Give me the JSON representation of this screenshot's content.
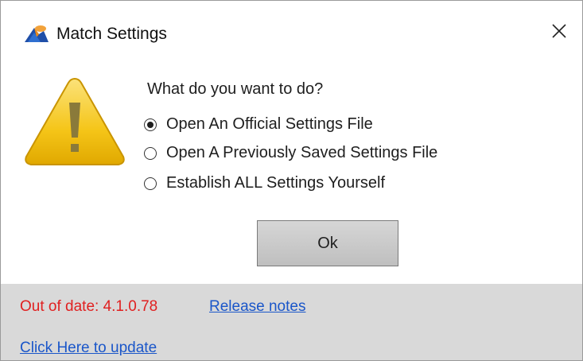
{
  "window": {
    "title": "Match Settings"
  },
  "dialog": {
    "question": "What do you want to do?",
    "options": [
      {
        "label": "Open An Official Settings File",
        "selected": true
      },
      {
        "label": "Open A Previously Saved Settings File",
        "selected": false
      },
      {
        "label": "Establish ALL Settings Yourself",
        "selected": false
      }
    ],
    "ok_label": "Ok"
  },
  "footer": {
    "status": "Out of date: 4.1.0.78",
    "release_notes_link": "Release notes",
    "update_link": "Click Here to update"
  },
  "icons": {
    "app": "app-logo-icon",
    "warning": "warning-icon",
    "close": "close-icon"
  },
  "colors": {
    "status_red": "#e02020",
    "link_blue": "#1a56c9",
    "footer_bg": "#d9d9d9",
    "warning_yellow": "#f5c518"
  }
}
